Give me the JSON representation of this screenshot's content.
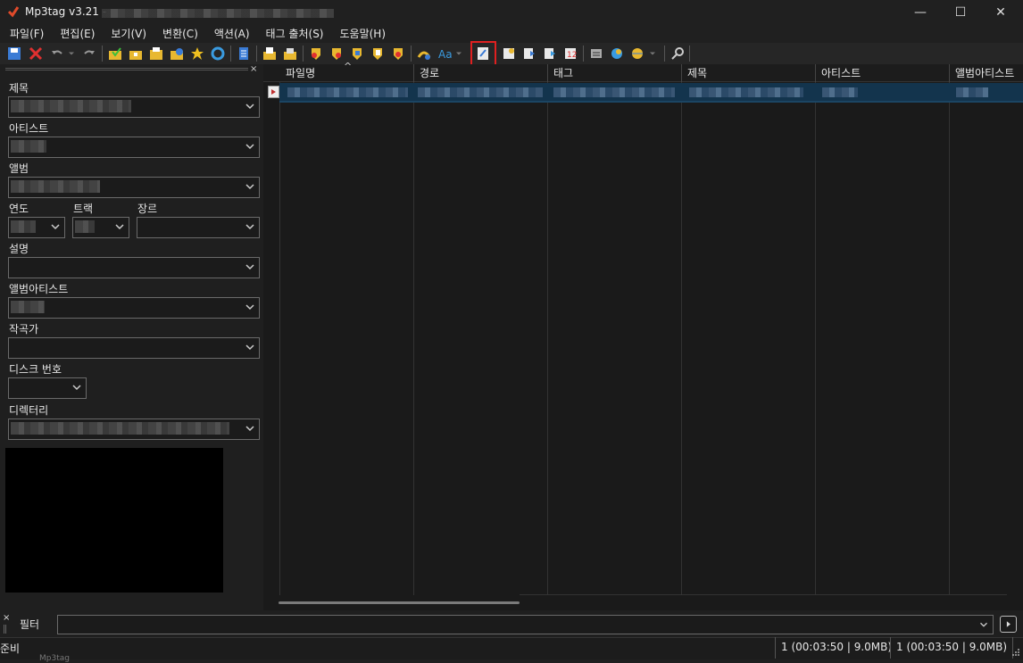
{
  "window": {
    "title": "Mp3tag v3.21 -",
    "minimize_icon": "minimize-icon",
    "maximize_icon": "maximize-icon",
    "close_icon": "close-icon"
  },
  "menu": [
    "파일(F)",
    "편집(E)",
    "보기(V)",
    "변환(C)",
    "액션(A)",
    "태그 출처(S)",
    "도움말(H)"
  ],
  "left_panel": {
    "title_label": "제목",
    "artist_label": "아티스트",
    "album_label": "앨범",
    "year_label": "연도",
    "track_label": "트랙",
    "genre_label": "장르",
    "comment_label": "설명",
    "album_artist_label": "앨범아티스트",
    "composer_label": "작곡가",
    "disc_label": "디스크 번호",
    "directory_label": "디렉터리",
    "close_glyph": "×"
  },
  "list": {
    "columns": [
      "파일명",
      "경로",
      "태그",
      "제목",
      "아티스트",
      "앨범아티스트"
    ],
    "sort_indicator": "^"
  },
  "filter": {
    "label": "필터",
    "value": "",
    "close_glyph": "×"
  },
  "status": {
    "text": "준비",
    "selection": "1 (00:03:50 | 9.0MB)",
    "total": "1 (00:03:50 | 9.0MB)"
  },
  "taskbar_peek": "Mp3tag",
  "colors": {
    "highlight": "#e02020",
    "selection_row": "#13344d",
    "background": "#1f1f1f"
  }
}
